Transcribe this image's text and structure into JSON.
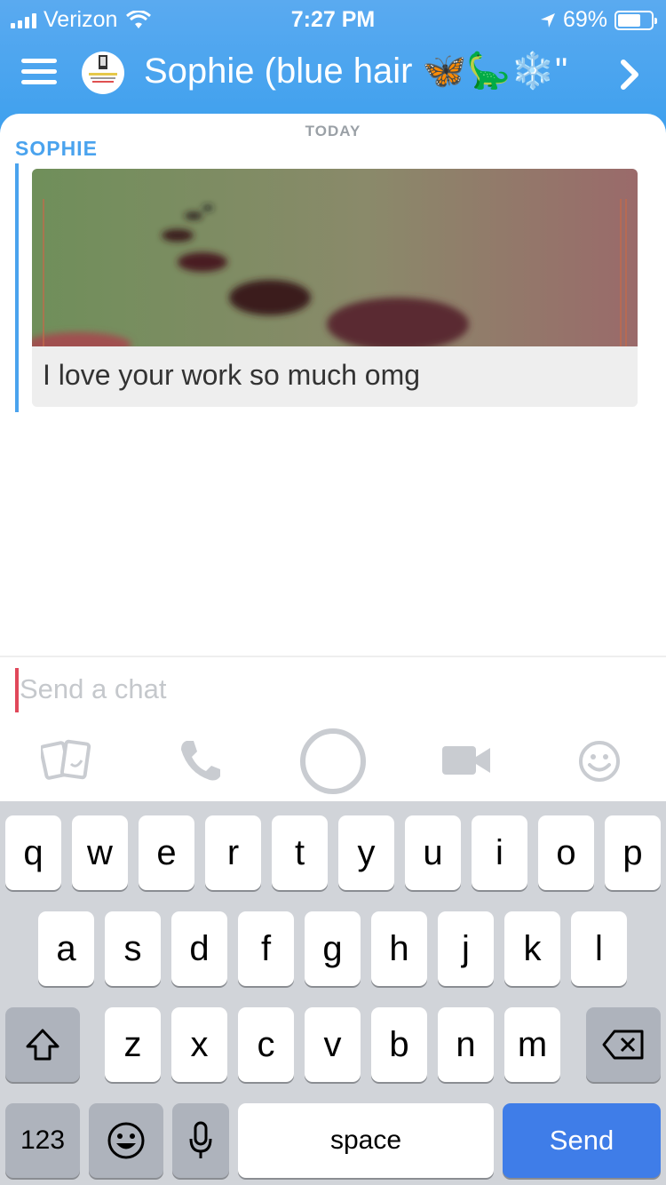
{
  "status_bar": {
    "carrier": "Verizon",
    "time": "7:27 PM",
    "battery": "69%",
    "battery_level": 0.69
  },
  "header": {
    "title": "Sophie (blue hair 🦋🦕❄️\""
  },
  "chat": {
    "date_separator": "TODAY",
    "sender": "SOPHIE",
    "message_caption": "I love your work so much omg"
  },
  "input": {
    "placeholder": "Send a chat"
  },
  "toolbar_icons": [
    "memories-icon",
    "phone-icon",
    "capture-icon",
    "video-icon",
    "emoji-icon"
  ],
  "keyboard": {
    "row1": [
      "q",
      "w",
      "e",
      "r",
      "t",
      "y",
      "u",
      "i",
      "o",
      "p"
    ],
    "row2": [
      "a",
      "s",
      "d",
      "f",
      "g",
      "h",
      "j",
      "k",
      "l"
    ],
    "row3": [
      "z",
      "x",
      "c",
      "v",
      "b",
      "n",
      "m"
    ],
    "numbers": "123",
    "space": "space",
    "send": "Send"
  },
  "colors": {
    "header": "#4aa6ef",
    "accent": "#4aa3ee",
    "send_key": "#3f7de8",
    "cursor": "#e0485a"
  }
}
